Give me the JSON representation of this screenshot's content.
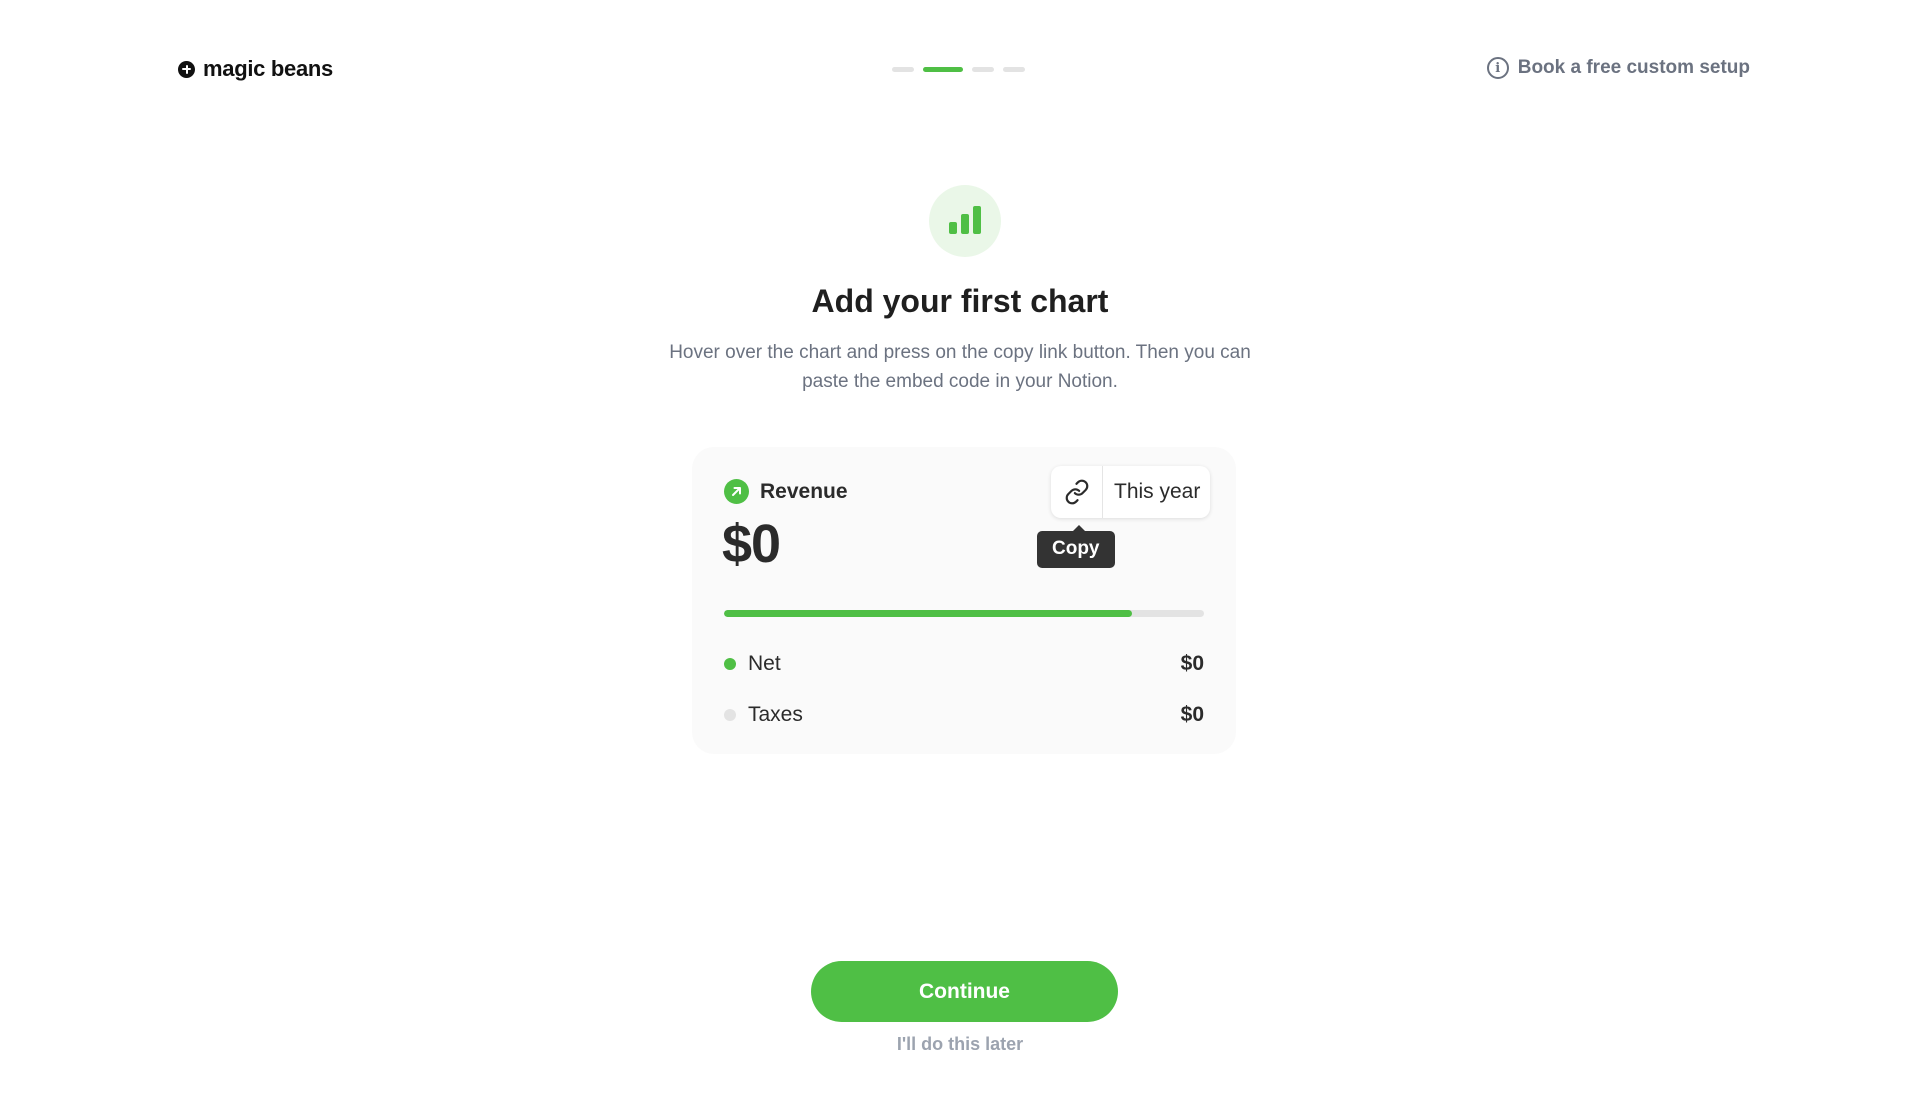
{
  "header": {
    "brand": "magic beans",
    "help_link": "Book a free custom setup",
    "steps_total": 4,
    "step_active": 2
  },
  "hero": {
    "title": "Add your first chart",
    "subtitle": "Hover over the chart and press on the copy link button. Then you can paste the embed code in your Notion."
  },
  "card": {
    "metric": "Revenue",
    "value": "$0",
    "period": "This year",
    "tooltip": "Copy",
    "progress": 0.85,
    "breakdown": [
      {
        "label": "Net",
        "value": "$0",
        "color": "#4fbf45"
      },
      {
        "label": "Taxes",
        "value": "$0",
        "color": "#e3e3e3"
      }
    ]
  },
  "footer": {
    "continue_label": "Continue",
    "later_label": "I'll do this later"
  },
  "colors": {
    "accent": "#4fbf45",
    "muted_text": "#6b7280",
    "card_bg": "#fafafa"
  }
}
